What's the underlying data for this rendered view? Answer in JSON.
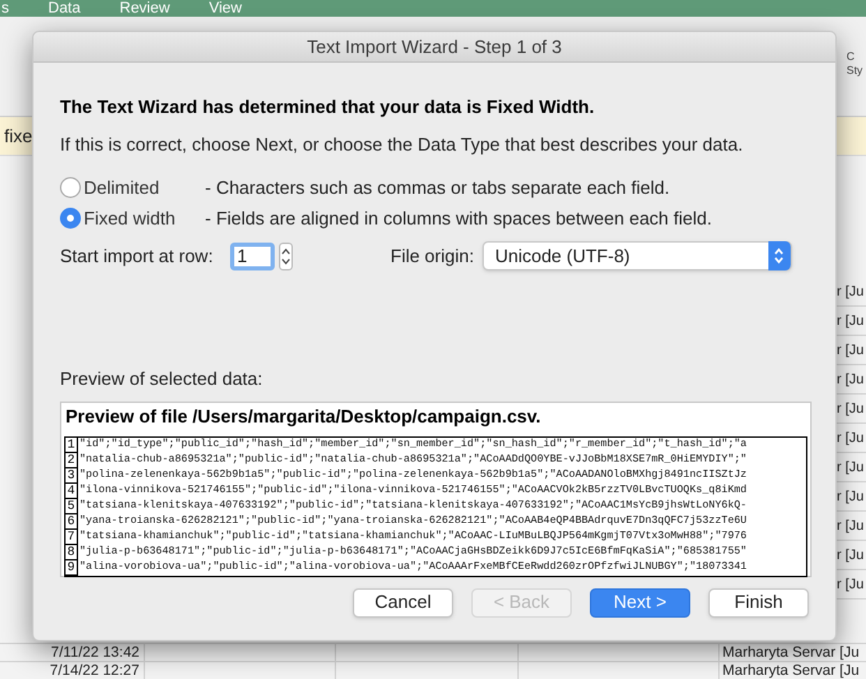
{
  "menu_bar": [
    "s",
    "Data",
    "Review",
    "View"
  ],
  "ribbon": {
    "style_label_1": "C",
    "style_label_2": "Sty"
  },
  "message_bar": {
    "text": "fixe"
  },
  "sheet": {
    "right_cells": [
      "r [Ju",
      "r [Ju",
      "r [Ju",
      "r [Ju",
      "r [Ju",
      "r [Ju",
      "r [Ju",
      "r [Ju",
      "r [Ju",
      "r [Ju",
      "r [Ju"
    ],
    "bottom_rows": [
      {
        "date": "7/11/22 13:42",
        "name": "Marharyta Servar [Ju"
      },
      {
        "date": "7/14/22 12:27",
        "name": "Marharyta Servar [Ju"
      }
    ]
  },
  "dialog": {
    "title": "Text Import Wizard - Step 1 of 3",
    "heading": "The Text Wizard has determined that your data is Fixed Width.",
    "instruction": "If this is correct, choose Next, or choose the Data Type that best describes your data.",
    "data_types": [
      {
        "label": "Delimited",
        "description": "- Characters such as commas or tabs separate each field.",
        "selected": false
      },
      {
        "label": "Fixed width",
        "description": "- Fields are aligned in columns with spaces between each field.",
        "selected": true
      }
    ],
    "start_row": {
      "label": "Start import at row:",
      "value": "1"
    },
    "file_origin": {
      "label": "File origin:",
      "value": "Unicode (UTF-8)"
    },
    "preview_label": "Preview of selected data:",
    "preview_title": "Preview of file /Users/margarita/Desktop/campaign.csv.",
    "preview_lines": [
      {
        "number": "1",
        "text": "\"id\";\"id_type\";\"public_id\";\"hash_id\";\"member_id\";\"sn_member_id\";\"sn_hash_id\";\"r_member_id\";\"t_hash_id\";\"a"
      },
      {
        "number": "2",
        "text": "\"natalia-chub-a8695321a\";\"public-id\";\"natalia-chub-a8695321a\";\"ACoAADdQO0YBE-vJJoBbM18XSE7mR_0HiEMYDIY\";\""
      },
      {
        "number": "3",
        "text": "\"polina-zelenenkaya-562b9b1a5\";\"public-id\";\"polina-zelenenkaya-562b9b1a5\";\"ACoAADANOloBMXhgj8491ncIISZtJz"
      },
      {
        "number": "4",
        "text": "\"ilona-vinnikova-521746155\";\"public-id\";\"ilona-vinnikova-521746155\";\"ACoAACVOk2kB5rzzTV0LBvcTUOQKs_q8iKmd"
      },
      {
        "number": "5",
        "text": "\"tatsiana-klenitskaya-407633192\";\"public-id\";\"tatsiana-klenitskaya-407633192\";\"ACoAAC1MsYcB9jhsWtLoNY6kQ-"
      },
      {
        "number": "6",
        "text": "\"yana-troianska-626282121\";\"public-id\";\"yana-troianska-626282121\";\"ACoAAB4eQP4BBAdrquvE7Dn3qQFC7j53zzTe6U"
      },
      {
        "number": "7",
        "text": "\"tatsiana-khamianchuk\";\"public-id\";\"tatsiana-khamianchuk\";\"ACoAAC-LIuMBuLBQJP564mKgmjT07Vtx3oMwH88\";\"7976"
      },
      {
        "number": "8",
        "text": "\"julia-p-b63648171\";\"public-id\";\"julia-p-b63648171\";\"ACoAACjaGHsBDZeikk6D9J7c5IcE6BfmFqKaSiA\";\"685381755\""
      },
      {
        "number": "9",
        "text": "\"alina-vorobiova-ua\";\"public-id\";\"alina-vorobiova-ua\";\"ACoAAArFxeMBfCEeRwdd260zrOPfzfwiJLNUBGY\";\"18073341"
      }
    ],
    "buttons": [
      {
        "label": "Cancel",
        "kind": "normal",
        "disabled": false
      },
      {
        "label": "< Back",
        "kind": "normal",
        "disabled": true
      },
      {
        "label": "Next >",
        "kind": "default",
        "disabled": false
      },
      {
        "label": "Finish",
        "kind": "normal",
        "disabled": false
      }
    ]
  }
}
